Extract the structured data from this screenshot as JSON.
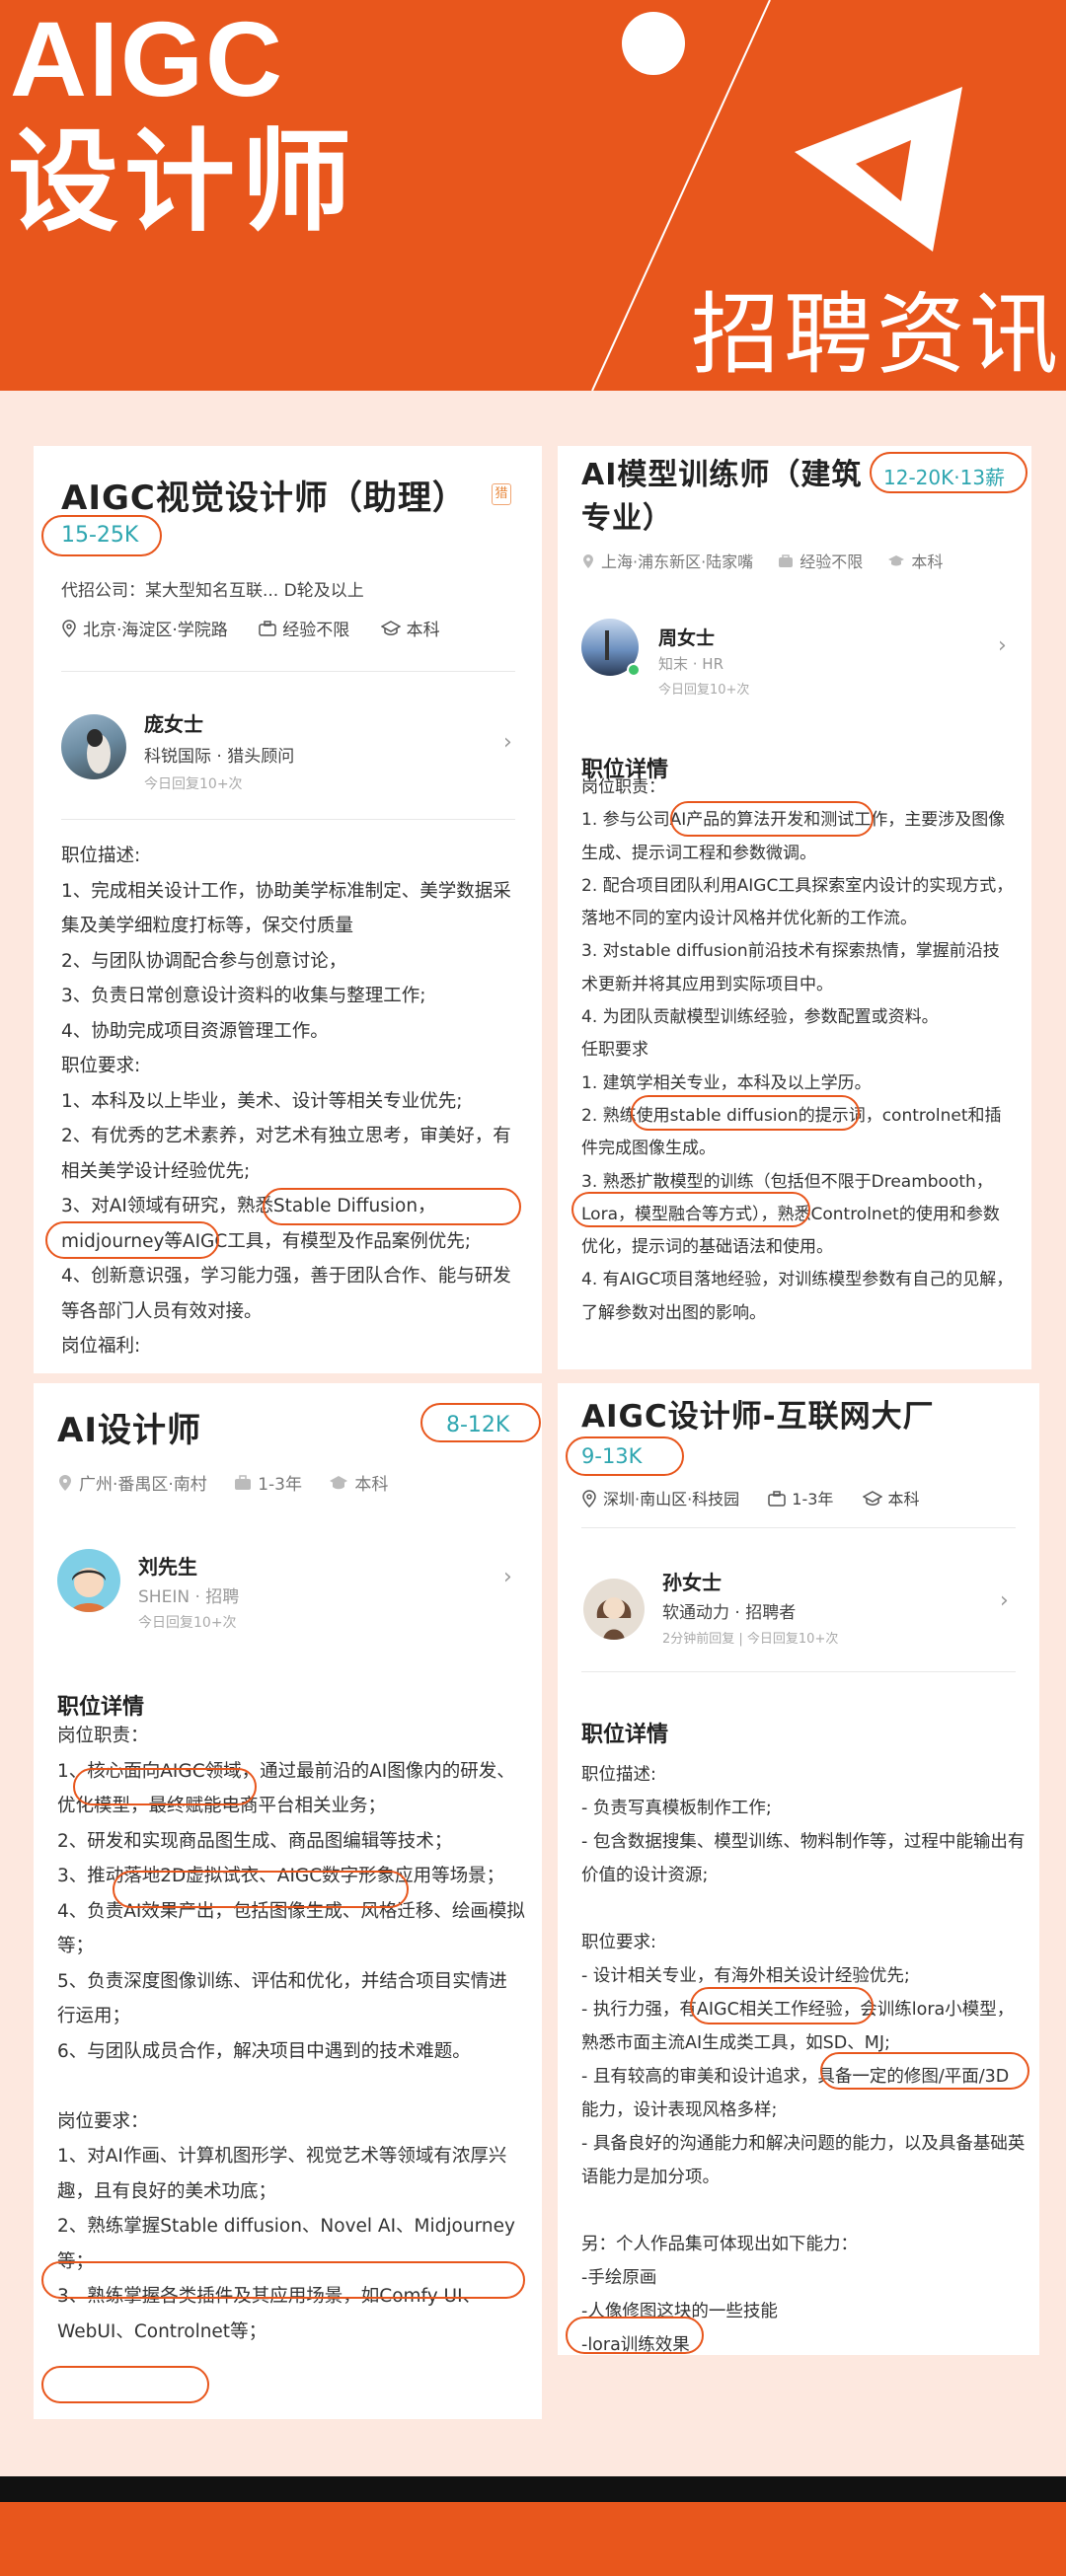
{
  "header": {
    "title_line1": "AIGC",
    "title_line2": "设计师",
    "subtitle": "招聘资讯"
  },
  "cards": [
    {
      "title": "AIGC视觉设计师（助理）",
      "badge": "猎",
      "salary": "15-25K",
      "company_line": "代招公司：某大型知名互联...     D轮及以上",
      "location": "北京·海淀区·学院路",
      "experience": "经验不限",
      "education": "本科",
      "hr": {
        "name": "庞女士",
        "role": "科锐国际 · 猎头顾问",
        "reply": "今日回复10+次"
      },
      "lines": [
        "职位描述:",
        "1、完成相关设计工作，协助美学标准制定、美学数据采集及美学细粒度打标等，保交付质量",
        "2、与团队协调配合参与创意讨论，",
        "3、负责日常创意设计资料的收集与整理工作;",
        "4、协助完成项目资源管理工作。",
        "职位要求:",
        "1、本科及以上毕业，美术、设计等相关专业优先;",
        "2、有优秀的艺术素养，对艺术有独立思考，审美好，有相关美学设计经验优先;",
        "3、对AI领域有研究，熟悉Stable Diffusion，midjourney等AIGC工具，有模型及作品案例优先;",
        "4、创新意识强，学习能力强，善于团队合作、能与研发等各部门人员有效对接。",
        "岗位福利:"
      ]
    },
    {
      "title": "AI模型训练师（建筑专业）",
      "salary": "12-20K·13薪",
      "location": "上海·浦东新区·陆家嘴",
      "experience": "经验不限",
      "education": "本科",
      "hr": {
        "name": "周女士",
        "role": "知末 · HR",
        "reply": "今日回复10+次"
      },
      "section_title": "职位详情",
      "lines": [
        "岗位职责：",
        "1. 参与公司AI产品的算法开发和测试工作，主要涉及图像生成、提示词工程和参数微调。",
        "2. 配合项目团队利用AIGC工具探索室内设计的实现方式，落地不同的室内设计风格并优化新的工作流。",
        "3. 对stable diffusion前沿技术有探索热情，掌握前沿技术更新并将其应用到实际项目中。",
        "4. 为团队贡献模型训练经验，参数配置或资料。",
        "任职要求",
        "1. 建筑学相关专业，本科及以上学历。",
        "2. 熟练使用stable diffusion的提示词，controlnet和插件完成图像生成。",
        "3. 熟悉扩散模型的训练（包括但不限于Dreambooth，Lora，模型融合等方式），熟悉Controlnet的使用和参数优化，提示词的基础语法和使用。",
        "4. 有AIGC项目落地经验，对训练模型参数有自己的见解，了解参数对出图的影响。"
      ]
    },
    {
      "title": "AI设计师",
      "salary": "8-12K",
      "location": "广州·番禺区·南村",
      "experience": "1-3年",
      "education": "本科",
      "hr": {
        "name": "刘先生",
        "role": "SHEIN · 招聘",
        "reply": "今日回复10+次"
      },
      "section_title": "职位详情",
      "lines": [
        "岗位职责：",
        "1、核心面向AIGC领域，通过最前沿的AI图像内的研发、优化模型，最终赋能电商平台相关业务；",
        "2、研发和实现商品图生成、商品图编辑等技术；",
        "3、推动落地2D虚拟试衣、AIGC数字形象应用等场景；",
        "4、负责AI效果产出，包括图像生成、风格迁移、绘画模拟等；",
        "5、负责深度图像训练、评估和优化，并结合项目实情进行运用；",
        "6、与团队成员合作，解决项目中遇到的技术难题。",
        "",
        "岗位要求：",
        "1、对AI作画、计算机图形学、视觉艺术等领域有浓厚兴趣，且有良好的美术功底；",
        "2、熟练掌握Stable diffusion、Novel AI、Midjourney等；",
        "3、熟练掌握各类插件及其应用场景，如Comfy UI、WebUI、Controlnet等；"
      ]
    },
    {
      "title": "AIGC设计师-互联网大厂",
      "salary": "9-13K",
      "location": "深圳·南山区·科技园",
      "experience": "1-3年",
      "education": "本科",
      "hr": {
        "name": "孙女士",
        "role": "软通动力 · 招聘者",
        "reply": "2分钟前回复 | 今日回复10+次"
      },
      "section_title": "职位详情",
      "lines": [
        "职位描述:",
        "- 负责写真模板制作工作;",
        "- 包含数据搜集、模型训练、物料制作等，过程中能输出有价值的设计资源;",
        "",
        "职位要求:",
        "- 设计相关专业，有海外相关设计经验优先;",
        "- 执行力强，有AIGC相关工作经验，会训练lora小模型，熟悉市面主流AI生成类工具，如SD、MJ;",
        "- 且有较高的审美和设计追求，具备一定的修图/平面/3D能力，设计表现风格多样;",
        "- 具备良好的沟通能力和解决问题的能力，以及具备基础英语能力是加分项。",
        "",
        "另：个人作品集可体现出如下能力：",
        "-手绘原画",
        "-人像修图这块的一些技能",
        "-lora训练效果"
      ]
    }
  ],
  "colors": {
    "accent": "#e8561c",
    "salary": "#2ea6b0",
    "background": "#fde8df"
  }
}
